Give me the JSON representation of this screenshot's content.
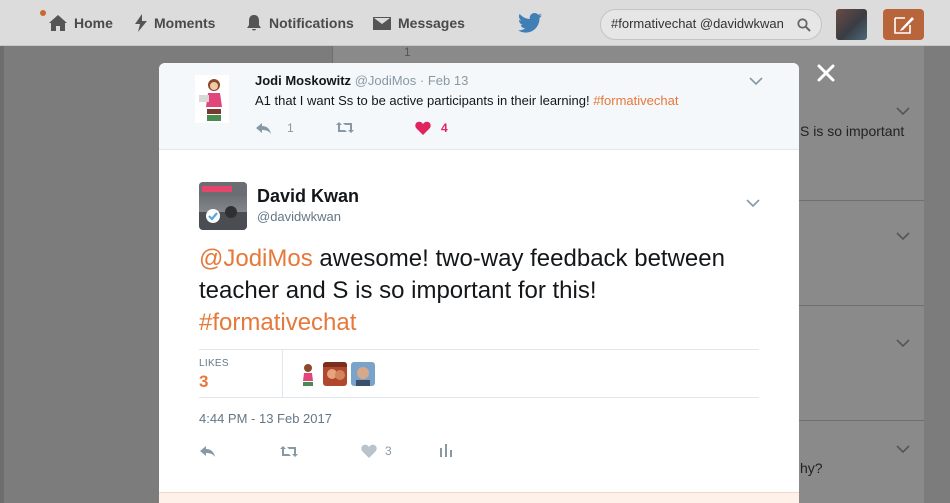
{
  "nav": {
    "home": "Home",
    "moments": "Moments",
    "notifications": "Notifications",
    "messages": "Messages",
    "search_value": "#formativechat @davidwkwan"
  },
  "background": {
    "reply_count": "1",
    "snippet_1": "S is so important",
    "snippet_2": "hy?"
  },
  "parent_tweet": {
    "name": "Jodi Moskowitz",
    "handle": "@JodiMos",
    "date": "· Feb 13",
    "text": "A1 that I want Ss to be active participants in their learning! ",
    "hashtag": "#formativechat",
    "replies": "1",
    "likes": "4"
  },
  "main_tweet": {
    "name": "David Kwan",
    "handle": "@davidwkwan",
    "mention": "@JodiMos",
    "text": " awesome! two-way feedback between teacher and S is so important for this! ",
    "hashtag": "#formativechat",
    "likes_label": "LIKES",
    "likes_count": "3",
    "timestamp": "4:44 PM - 13 Feb 2017",
    "action_likes": "3"
  },
  "colors": {
    "accent": "#e6783a",
    "heart": "#e0245e",
    "muted": "#8899a6"
  }
}
